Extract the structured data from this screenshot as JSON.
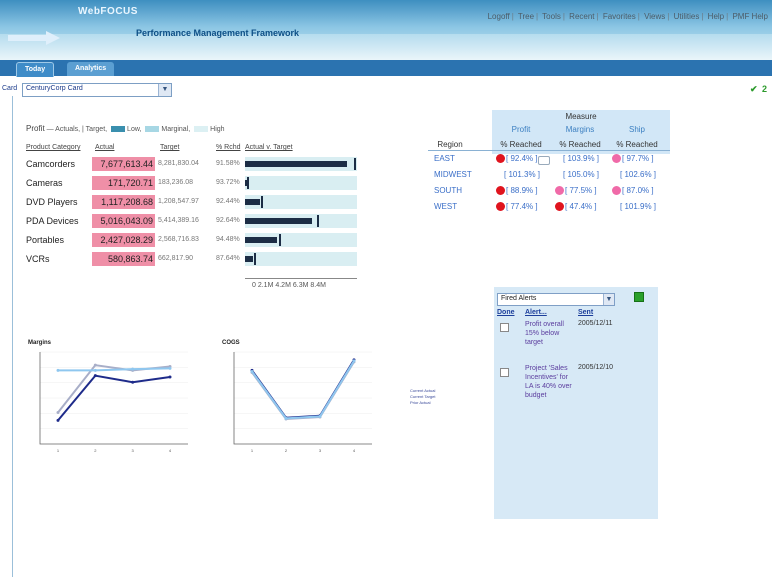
{
  "header": {
    "brand": "WebFOCUS",
    "subtitle": "Performance Management Framework",
    "nav": [
      "Logoff",
      "Tree",
      "Tools",
      "Recent",
      "Favorites",
      "Views",
      "Utilities",
      "Help",
      "PMF Help"
    ]
  },
  "tabs": [
    {
      "label": "Today"
    },
    {
      "label": "Analytics"
    }
  ],
  "card": {
    "label": "Card",
    "value": "CenturyCorp Card"
  },
  "legend": {
    "title": "Profit",
    "actual": "— Actuals,",
    "target": "| Target,",
    "low": "Low,",
    "marginal": "Marginal,",
    "high": "High"
  },
  "table": {
    "headers": [
      "Product Category",
      "Actual",
      "Target",
      "% Rchd",
      "Actual v. Target"
    ],
    "rows": [
      {
        "category": "Camcorders",
        "actual": "7,677,613.44",
        "target": "8,281,830.04",
        "pct": "91.58%",
        "fill": 0.91,
        "mark": 0.99
      },
      {
        "category": "Cameras",
        "actual": "171,720.71",
        "target": "183,236.08",
        "pct": "93.72%",
        "fill": 0.02,
        "mark": 0.022
      },
      {
        "category": "DVD Players",
        "actual": "1,117,208.68",
        "target": "1,208,547.97",
        "pct": "92.44%",
        "fill": 0.13,
        "mark": 0.145
      },
      {
        "category": "PDA Devices",
        "actual": "5,016,043.09",
        "target": "5,414,389.16",
        "pct": "92.64%",
        "fill": 0.6,
        "mark": 0.65
      },
      {
        "category": "Portables",
        "actual": "2,427,028.29",
        "target": "2,568,716.83",
        "pct": "94.48%",
        "fill": 0.29,
        "mark": 0.31
      },
      {
        "category": "VCRs",
        "actual": "580,863.74",
        "target": "662,817.90",
        "pct": "87.64%",
        "fill": 0.07,
        "mark": 0.08
      }
    ],
    "axis": "0  2.1M  4.2M  6.3M  8.4M"
  },
  "measure": {
    "title": "Measure",
    "region_header": "Region",
    "columns": [
      {
        "name": "Profit",
        "sub": "% Reached"
      },
      {
        "name": "Margins",
        "sub": "% Reached"
      },
      {
        "name": "Ship",
        "sub": "% Reached"
      }
    ],
    "rows": [
      {
        "region": "EAST",
        "values": [
          "[ 92.4% ]",
          "[ 103.9% ]",
          "[ 97.7% ]"
        ],
        "dots": [
          "#e0141e",
          null,
          "#f06aa8"
        ]
      },
      {
        "region": "MIDWEST",
        "values": [
          "[ 101.3% ]",
          "[ 105.0% ]",
          "[ 102.6% ]"
        ],
        "dots": [
          null,
          null,
          null
        ]
      },
      {
        "region": "SOUTH",
        "values": [
          "[ 88.9% ]",
          "[ 77.5% ]",
          "[ 87.0% ]"
        ],
        "dots": [
          "#e0141e",
          "#f06aa8",
          "#f06aa8"
        ]
      },
      {
        "region": "WEST",
        "values": [
          "[ 77.4% ]",
          "[ 47.4% ]",
          "[ 101.9% ]"
        ],
        "dots": [
          "#e0141e",
          "#e0141e",
          null
        ]
      }
    ]
  },
  "chart_data": [
    {
      "type": "line",
      "title": "Margins",
      "x": [
        1,
        2,
        3,
        4
      ],
      "series": [
        {
          "values": [
            180,
            520,
            470,
            510
          ],
          "color": "#1e2b8a"
        },
        {
          "values": [
            240,
            600,
            560,
            590
          ],
          "color": "#a8aec8"
        },
        {
          "values": [
            560,
            560,
            570,
            575
          ],
          "color": "#8fc7ef"
        }
      ]
    },
    {
      "type": "line",
      "title": "COGS",
      "x": [
        1,
        2,
        3,
        4
      ],
      "series": [
        {
          "values": [
            560,
            200,
            215,
            640
          ],
          "color": "#1e2b8a"
        },
        {
          "values": [
            545,
            190,
            205,
            625
          ],
          "color": "#a8aec8"
        },
        {
          "values": [
            552,
            195,
            210,
            632
          ],
          "color": "#8fc7ef"
        }
      ],
      "legend": [
        "Current Actual",
        "Current Target",
        "Prior Actual"
      ]
    }
  ],
  "alerts": {
    "filter": "Fired Alerts",
    "headers": [
      "Done",
      "Alert...",
      "Sent"
    ],
    "items": [
      {
        "text": "Profit overall 15% below target",
        "date": "2005/12/11"
      },
      {
        "text": "Project 'Sales Incentives' for LA is 40% over budget",
        "date": "2005/12/10"
      }
    ]
  }
}
